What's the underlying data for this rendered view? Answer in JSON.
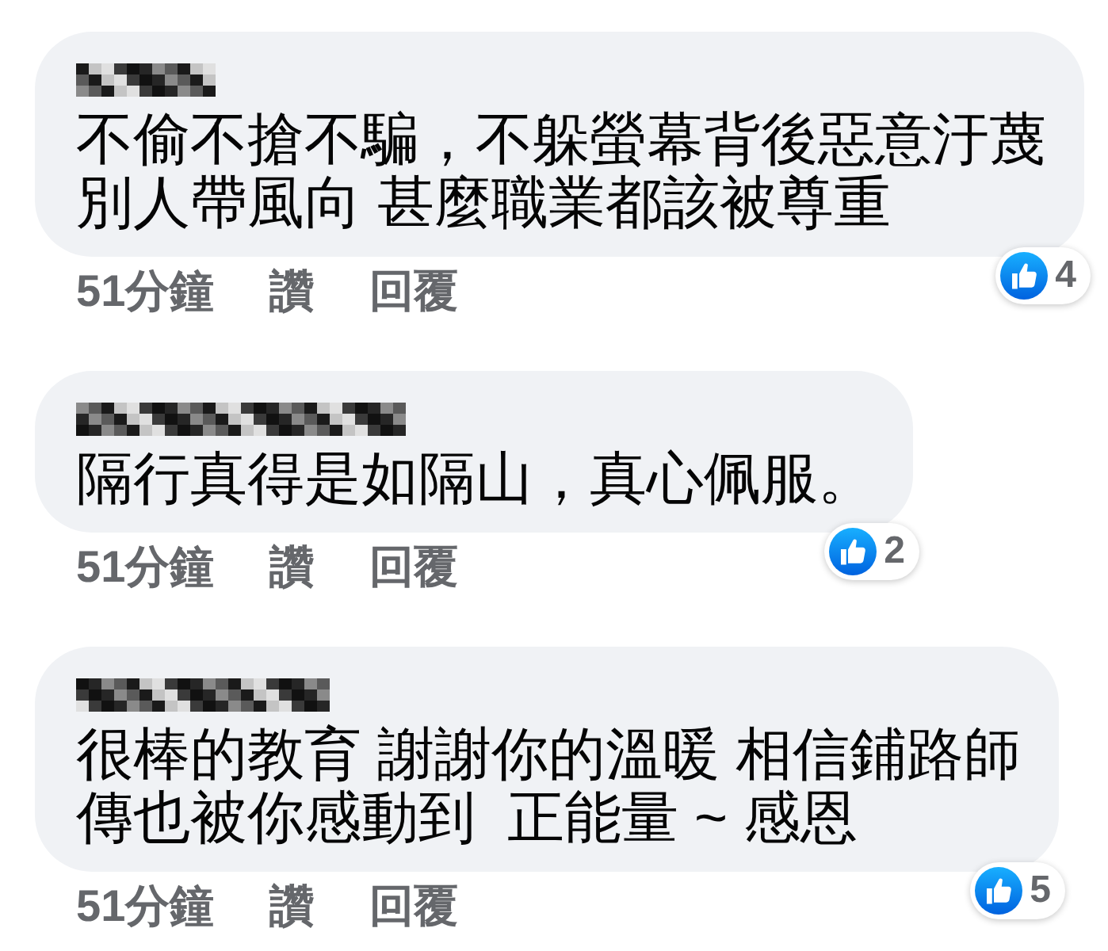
{
  "comments": [
    {
      "lines": [
        "不偷不搶不騙，不躲螢幕背後惡意汙蔑",
        "別人帶風向 甚麼職業都該被尊重"
      ],
      "time": "51分鐘",
      "actions": [
        "讚",
        "回覆"
      ],
      "reaction_count": "4"
    },
    {
      "lines": [
        "隔行真得是如隔山，真心佩服。"
      ],
      "time": "51分鐘",
      "actions": [
        "讚",
        "回覆"
      ],
      "reaction_count": "2"
    },
    {
      "lines": [
        "很棒的教育 謝謝你的溫暖 相信鋪路師",
        "傳也被你感動到  正能量 ~ 感恩"
      ],
      "time": "51分鐘",
      "actions": [
        "讚",
        "回覆"
      ],
      "reaction_count": "5"
    }
  ]
}
